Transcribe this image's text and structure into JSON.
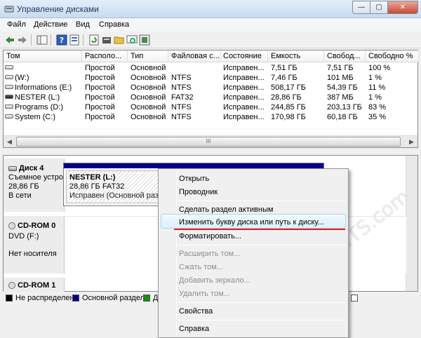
{
  "window": {
    "title": "Управление дисками",
    "min": "—",
    "max": "▢",
    "close": "✕"
  },
  "menu": [
    "Файл",
    "Действие",
    "Вид",
    "Справка"
  ],
  "toolbar_icons": [
    "back-arrow-icon",
    "forward-arrow-icon",
    "console-tree-icon",
    "help-icon",
    "properties-icon",
    "refresh-icon",
    "disk-properties-icon",
    "open-folder-icon",
    "rescan-icon",
    "settings-icon"
  ],
  "volumes": {
    "columns": [
      "Том",
      "Располо...",
      "Тип",
      "Файловая с...",
      "Состояние",
      "Емкость",
      "Свобод...",
      "Свободно %"
    ],
    "rows": [
      [
        "",
        "Простой",
        "Основной",
        "",
        "Исправен...",
        "7,51 ГБ",
        "7,51 ГБ",
        "100 %"
      ],
      [
        "(W:)",
        "Простой",
        "Основной",
        "NTFS",
        "Исправен...",
        "7,46 ГБ",
        "101 МБ",
        "1 %"
      ],
      [
        "Informations (E:)",
        "Простой",
        "Основной",
        "NTFS",
        "Исправен...",
        "508,17 ГБ",
        "54,39 ГБ",
        "11 %"
      ],
      [
        "NESTER (L:)",
        "Простой",
        "Основной",
        "FAT32",
        "Исправен...",
        "28,86 ГБ",
        "387 МБ",
        "1 %"
      ],
      [
        "Programs (D:)",
        "Простой",
        "Основной",
        "NTFS",
        "Исправен...",
        "244,85 ГБ",
        "203,13 ГБ",
        "83 %"
      ],
      [
        "System (C:)",
        "Простой",
        "Основной",
        "NTFS",
        "Исправен...",
        "170,98 ГБ",
        "60,18 ГБ",
        "35 %"
      ]
    ],
    "scroll_glyph": "III"
  },
  "disks": [
    {
      "name": "Диск 4",
      "type": "Съемное устро",
      "size": "28,86 ГБ",
      "status": "В сети"
    },
    {
      "name": "CD-ROM 0",
      "type": "DVD (F:)",
      "status": "Нет носителя"
    },
    {
      "name": "CD-ROM 1"
    }
  ],
  "partition": {
    "name": "NESTER (L:)",
    "size": "28,86 ГБ FAT32",
    "status": "Исправен (Основной разд"
  },
  "legend": [
    {
      "label": "Не распределен",
      "color": "#000000"
    },
    {
      "label": "Основной раздел",
      "color": "#00008b"
    },
    {
      "label": "Д",
      "color": "#1a8a1a"
    }
  ],
  "context_menu": [
    {
      "label": "Открыть",
      "enabled": true
    },
    {
      "label": "Проводник",
      "enabled": true
    },
    {
      "label": "Сделать раздел активным",
      "enabled": true
    },
    {
      "label": "Изменить букву диска или путь к диску...",
      "enabled": true,
      "highlighted": true
    },
    {
      "label": "Форматировать...",
      "enabled": true
    },
    {
      "label": "Расширить том...",
      "enabled": false
    },
    {
      "label": "Сжать том...",
      "enabled": false
    },
    {
      "label": "Добавить зеркало...",
      "enabled": false
    },
    {
      "label": "Удалить том...",
      "enabled": false
    },
    {
      "label": "Свойства",
      "enabled": true
    },
    {
      "label": "Справка",
      "enabled": true
    }
  ],
  "watermark": "HobbyITS.com"
}
